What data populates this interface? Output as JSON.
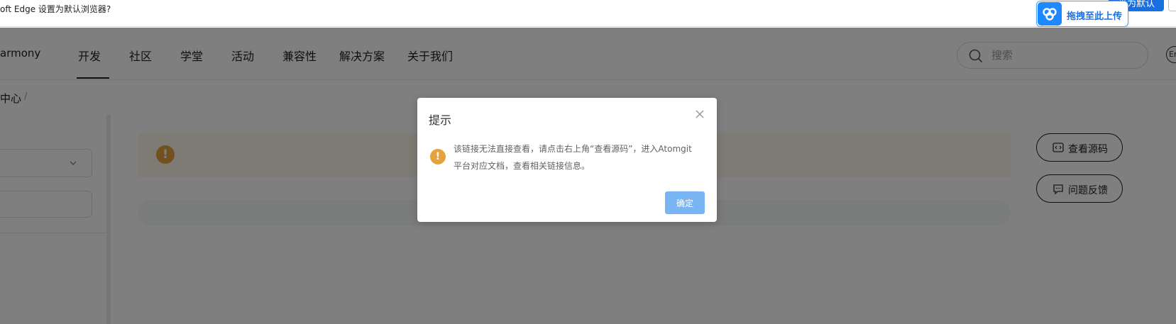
{
  "infobar": {
    "text": "oft Edge 设置为默认浏览器?",
    "default_button": "设为默认"
  },
  "upload_widget": {
    "label": "拖拽至此上传",
    "icon": "baidu-netdisk-icon"
  },
  "nav": {
    "brand": "armony",
    "items": [
      {
        "label": "开发",
        "active": true
      },
      {
        "label": "社区"
      },
      {
        "label": "学堂"
      },
      {
        "label": "活动"
      },
      {
        "label": "兼容性"
      },
      {
        "label": "解决方案"
      },
      {
        "label": "关于我们"
      }
    ],
    "search_placeholder": "搜索",
    "lang": "En"
  },
  "breadcrumb": {
    "current": "中心",
    "separator": "/"
  },
  "alert": {
    "icon": "!"
  },
  "side_actions": {
    "view_source": "查看源码",
    "feedback": "问题反馈"
  },
  "dialog": {
    "title": "提示",
    "icon": "!",
    "message": "该链接无法直接查看，请点击右上角“查看源码”，进入Atomgit平台对应文档，查看相关链接信息。",
    "ok_label": "确定"
  },
  "colors": {
    "warning": "#e6a23c",
    "primary_light": "#7ab5f3",
    "overlay": "rgba(0,0,0,0.5)"
  }
}
